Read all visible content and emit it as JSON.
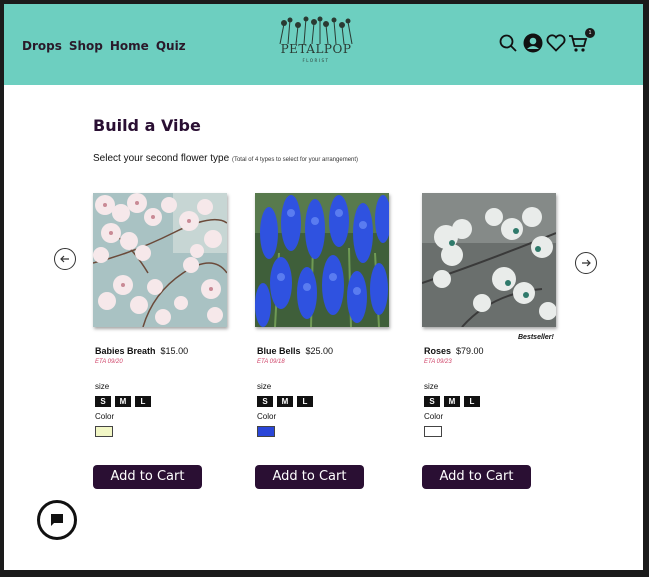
{
  "nav": [
    "Drops",
    "Shop",
    "Home",
    "Quiz"
  ],
  "brand": {
    "name": "PETALPOP",
    "tagline": "FLORIST"
  },
  "header": {
    "color": "#6dcfc0",
    "cart_count": "1",
    "icons": [
      "search-icon",
      "user-icon",
      "heart-icon",
      "cart-icon"
    ]
  },
  "page": {
    "title": "Build a Vibe",
    "prompt": "Select your second flower type",
    "prompt_note": "(Total of 4 types to select for your arrangement)"
  },
  "labels": {
    "size": "size",
    "color": "Color",
    "sizes": [
      "S",
      "M",
      "L"
    ],
    "add_to_cart": "Add to Cart"
  },
  "products": [
    {
      "name": "Babies Breath",
      "price": "$15.00",
      "eta": "ETA 09/20",
      "swatch": "#f2f7c6",
      "badge": ""
    },
    {
      "name": "Blue Bells",
      "price": "$25.00",
      "eta": "ETA 09/18",
      "swatch": "#2a46d8",
      "badge": ""
    },
    {
      "name": "Roses",
      "price": "$79.00",
      "eta": "ETA 09/23",
      "swatch": "#ffffff",
      "badge": "Bestseller!"
    }
  ],
  "colors": {
    "accent": "#2a0f33",
    "eta": "#d0456a"
  }
}
